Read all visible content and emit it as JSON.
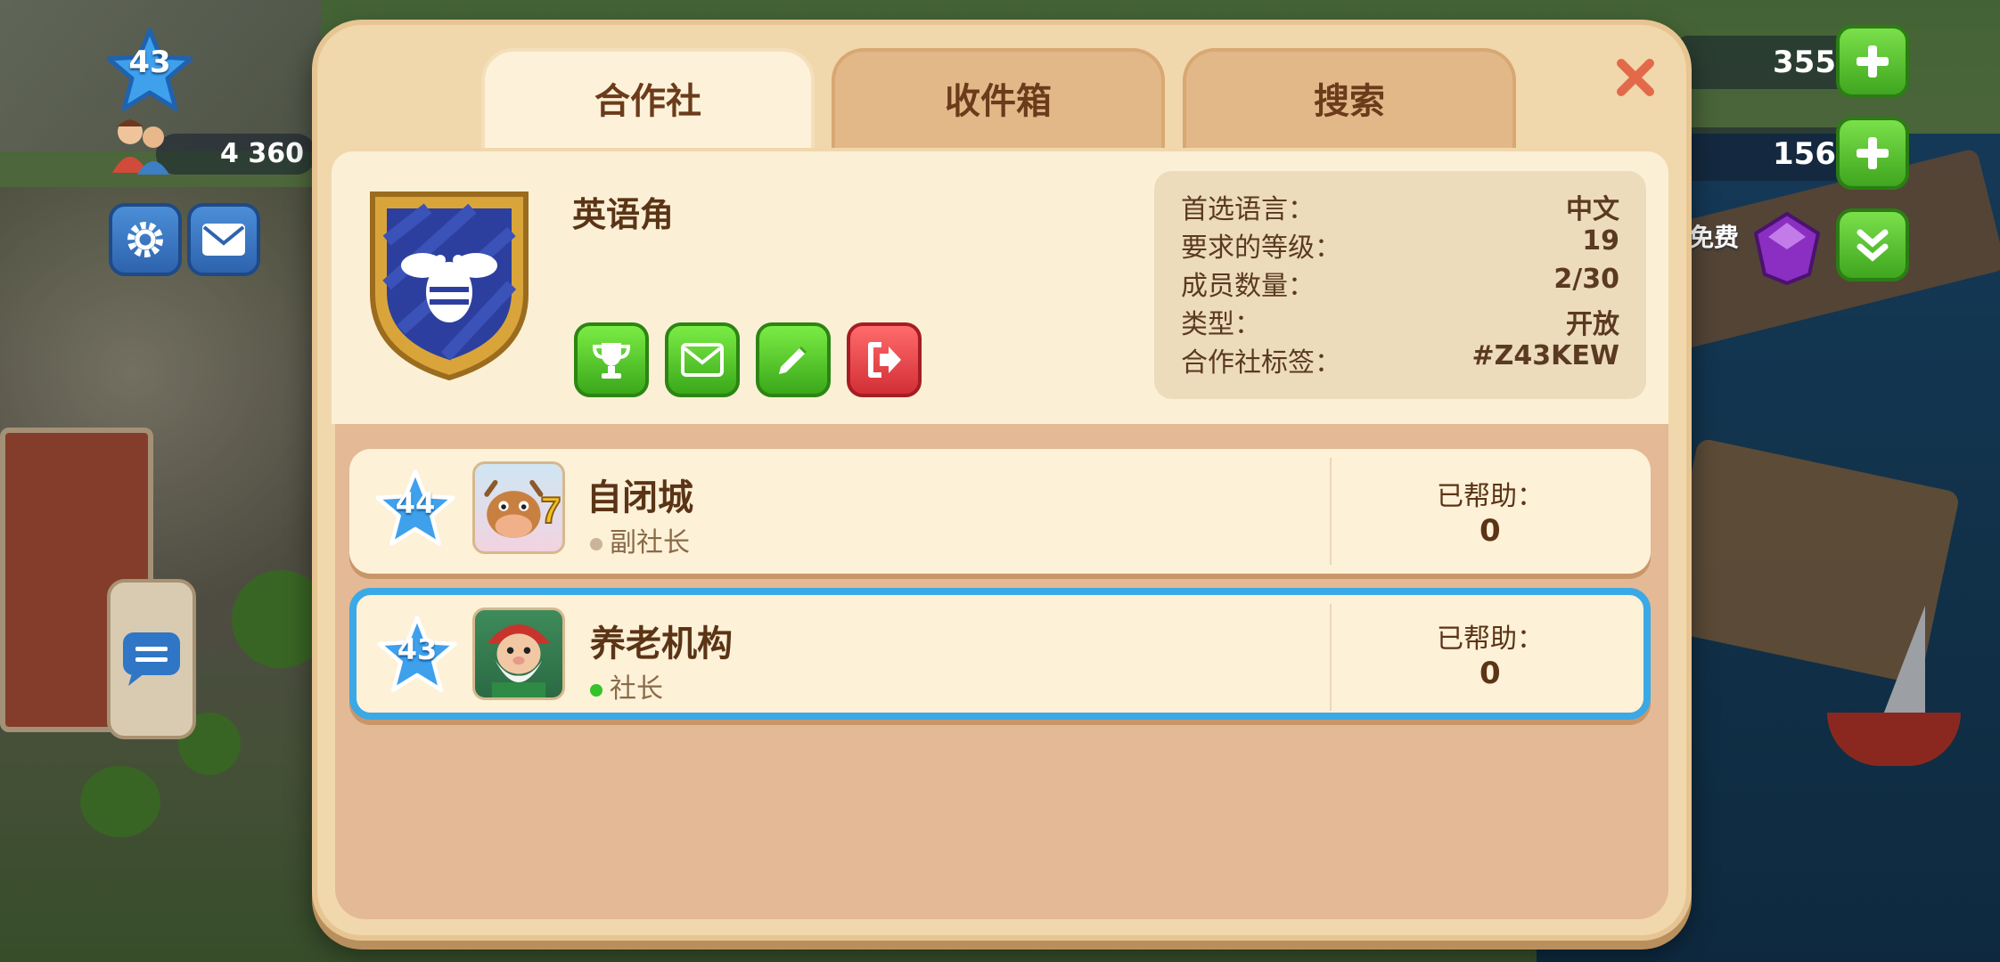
{
  "hud": {
    "player_level": "43",
    "population": "4 360",
    "resource_1": "355",
    "resource_2": "156",
    "free_label": "免费"
  },
  "tabs": [
    {
      "label": "合作社",
      "active": true
    },
    {
      "label": "收件箱",
      "active": false
    },
    {
      "label": "搜索",
      "active": false
    }
  ],
  "club": {
    "name": "英语角",
    "details": [
      {
        "label": "首选语言：",
        "value": "中文"
      },
      {
        "label": "要求的等级：",
        "value": "19"
      },
      {
        "label": "成员数量：",
        "value": "2/30"
      },
      {
        "label": "类型：",
        "value": "开放"
      },
      {
        "label": "合作社标签：",
        "value": "#Z43KEW"
      }
    ],
    "actions": [
      "trophy-icon",
      "mail-icon",
      "pencil-icon",
      "leave-icon"
    ]
  },
  "members": [
    {
      "level": "44",
      "name": "自闭城",
      "role": "副社长",
      "role_color": "#c9b49a",
      "helped_label": "已帮助：",
      "helped_value": "0",
      "selected": false
    },
    {
      "level": "43",
      "name": "养老机构",
      "role": "社长",
      "role_color": "#35c22a",
      "helped_label": "已帮助：",
      "helped_value": "0",
      "selected": true
    }
  ],
  "colors": {
    "dialog_bg": "#f1d7ac",
    "tab_active": "#fdf2d9",
    "tab_inactive": "#e3b889",
    "green_button": "#3aa81a",
    "red_button": "#d22f36",
    "selected_border": "#3ba9e6"
  }
}
